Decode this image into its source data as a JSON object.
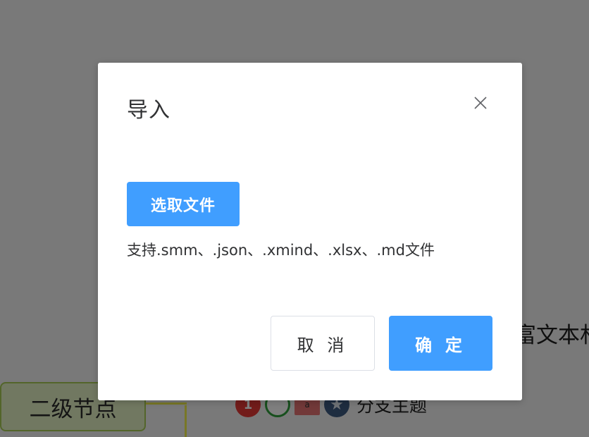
{
  "background": {
    "secondary_node_label": "二级节点",
    "branch_topic_label": "分支主题",
    "rich_text_label": "富文本林",
    "tag_icons": [
      "priority-icon",
      "progress-icon",
      "tag-icon",
      "star-icon"
    ]
  },
  "dialog": {
    "title": "导入",
    "choose_file_label": "选取文件",
    "hint": "支持.smm、.json、.xmind、.xlsx、.md文件",
    "cancel_label": "取 消",
    "confirm_label": "确 定",
    "close_icon": "close-icon"
  },
  "colors": {
    "primary": "#409eff",
    "overlay": "rgba(0,0,0,0.5)",
    "node_fill": "#e2f1c2",
    "node_border": "#a6cb55"
  }
}
